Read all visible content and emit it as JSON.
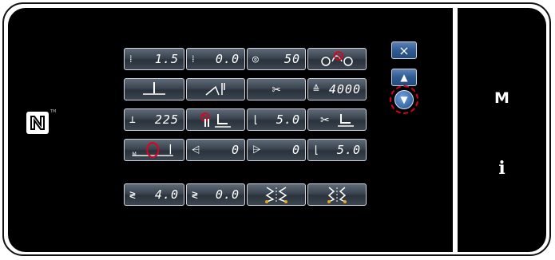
{
  "grid": {
    "row1": [
      {
        "value": "1.5",
        "icon": "stitch-length-icon"
      },
      {
        "value": "0.0",
        "icon": "stitch-offset-icon"
      },
      {
        "value": "50",
        "icon": "thread-tension-icon"
      },
      {
        "value": "",
        "icon": "thread-trim-disabled-icon"
      }
    ],
    "row2": [
      {
        "value": "",
        "icon": "needle-position-icon"
      },
      {
        "value": "",
        "icon": "presser-lift-icon"
      },
      {
        "value": "",
        "icon": "scissors-icon"
      },
      {
        "value": "4000",
        "icon": "counter-icon"
      }
    ],
    "row3": [
      {
        "value": "225",
        "icon": "needle-stop-icon"
      },
      {
        "value": "",
        "icon": "foot-no-lift-icon"
      },
      {
        "value": "5.0",
        "icon": "foot-height-icon"
      },
      {
        "value": "",
        "icon": "trim-and-lift-icon"
      }
    ],
    "row4": [
      {
        "value": "",
        "icon": "manual-reverse-icon"
      },
      {
        "value": "0",
        "icon": "start-backtack-icon"
      },
      {
        "value": "0",
        "icon": "end-backtack-icon"
      },
      {
        "value": "5.0",
        "icon": "foot-lift-amount-icon"
      }
    ],
    "row5": [
      {
        "value": "4.0",
        "icon": "zigzag-width-icon"
      },
      {
        "value": "0.0",
        "icon": "zigzag-base-icon"
      },
      {
        "value": "",
        "icon": "zigzag-pattern-a-icon"
      },
      {
        "value": "",
        "icon": "zigzag-pattern-b-icon"
      }
    ]
  },
  "controls": {
    "close": "×",
    "up": "▲",
    "down": "▼"
  },
  "side": {
    "mode_label": "M",
    "info_label": "i"
  },
  "colors": {
    "accent_red": "#e0001b",
    "button_blue": "#2f5a92",
    "panel": "#000000"
  }
}
